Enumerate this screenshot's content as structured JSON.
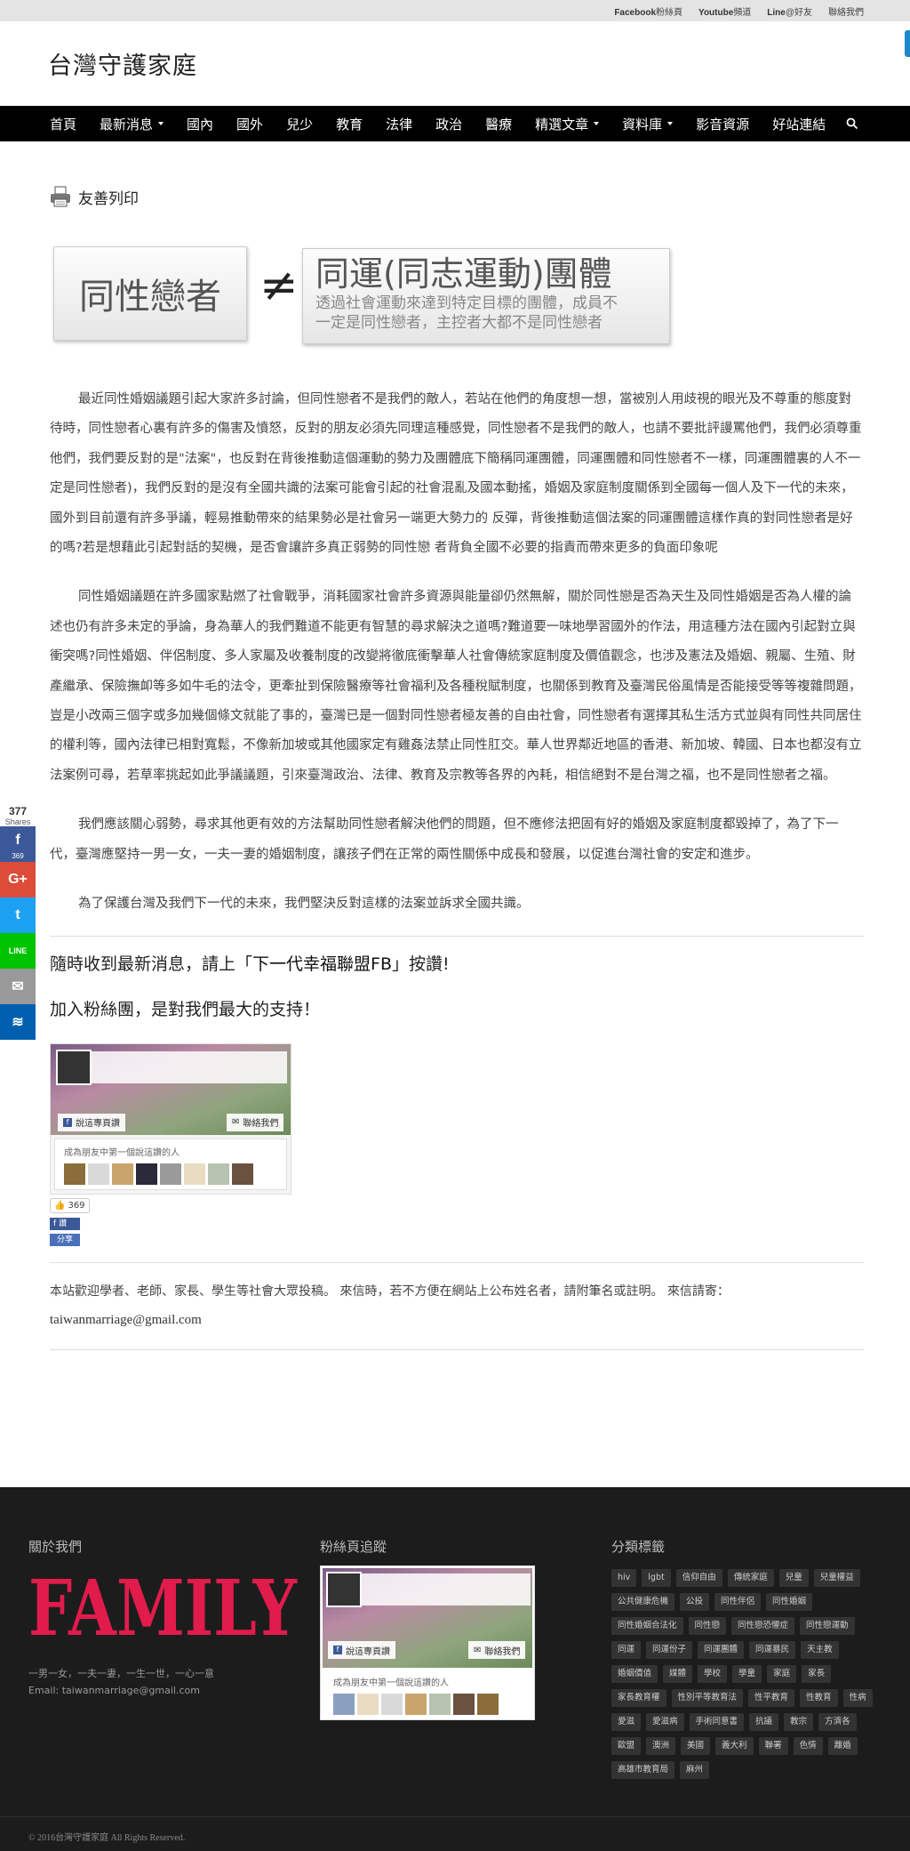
{
  "topbar": {
    "links": [
      {
        "bold": "Facebook",
        "rest": "粉絲頁"
      },
      {
        "bold": "Youtube",
        "rest": "頻道"
      },
      {
        "bold": "Line",
        "rest": "@好友"
      },
      {
        "bold": "",
        "rest": "聯絡我們"
      }
    ]
  },
  "site": {
    "title": "台灣守護家庭"
  },
  "nav": {
    "items": [
      {
        "label": "首頁",
        "dropdown": false
      },
      {
        "label": "最新消息",
        "dropdown": true
      },
      {
        "label": "國內",
        "dropdown": false
      },
      {
        "label": "國外",
        "dropdown": false
      },
      {
        "label": "兒少",
        "dropdown": false
      },
      {
        "label": "教育",
        "dropdown": false
      },
      {
        "label": "法律",
        "dropdown": false
      },
      {
        "label": "政治",
        "dropdown": false
      },
      {
        "label": "醫療",
        "dropdown": false
      },
      {
        "label": "精選文章",
        "dropdown": true
      },
      {
        "label": "資料庫",
        "dropdown": true
      },
      {
        "label": "影音資源",
        "dropdown": false
      },
      {
        "label": "好站連結",
        "dropdown": false
      }
    ],
    "search_icon": "search-icon"
  },
  "article": {
    "print_label": "友善列印",
    "banner": {
      "left": "同性戀者",
      "symbol": "≠",
      "right_title": "同運(同志運動)團體",
      "right_sub1": "透過社會運動來達到特定目標的團體，成員不",
      "right_sub2": "一定是同性戀者，主控者大都不是同性戀者"
    },
    "paragraphs": [
      "最近同性婚姻議題引起大家許多討論，但同性戀者不是我們的敵人，若站在他們的角度想一想，當被別人用歧視的眼光及不尊重的態度對待時，同性戀者心裏有許多的傷害及憤怒，反對的朋友必須先同理這種感覺，同性戀者不是我們的敵人，也請不要批評謾罵他們，我們必須尊重他們，我們要反對的是\"法案\"，也反對在背後推動這個運動的勢力及團體底下簡稱同運團體，同運團體和同性戀者不一樣，同運團體裏的人不一定是同性戀者)，我們反對的是沒有全國共識的法案可能會引起的社會混亂及國本動搖，婚姻及家庭制度關係到全國每一個人及下一代的未來，國外到目前還有許多爭議，輕易推動帶來的結果勢必是社會另一端更大勢力的 反彈，背後推動這個法案的同運團體這樣作真的對同性戀者是好的嗎?若是想藉此引起對話的契機，是否會讓許多真正弱勢的同性戀 者背負全國不必要的指責而帶來更多的負面印象呢",
      "同性婚姻議題在許多國家點燃了社會戰爭，消耗國家社會許多資源與能量卻仍然無解，關於同性戀是否為天生及同性婚姻是否為人權的論述也仍有許多未定的爭論，身為華人的我們難道不能更有智慧的尋求解決之道嗎?難道要一味地學習國外的作法，用這種方法在國內引起對立與衝突嗎?同性婚姻、伴侶制度、多人家屬及收養制度的改變將徹底衝擊華人社會傳統家庭制度及價值觀念，也涉及憲法及婚姻、親屬、生殖、財產繼承、保險撫卹等多如牛毛的法令，更牽扯到保險醫療等社會福利及各種稅賦制度，也關係到教育及臺灣民俗風情是否能接受等等複雜問題，豈是小改兩三個字或多加幾個條文就能了事的，臺灣已是一個對同性戀者極友善的自由社會，同性戀者有選擇其私生活方式並與有同性共同居住的權利等，國內法律已相對寬鬆，不像新加坡或其他國家定有雞姦法禁止同性肛交。華人世界鄰近地區的香港、新加坡、韓國、日本也都沒有立法案例可尋，若草率挑起如此爭議議題，引來臺灣政治、法律、教育及宗教等各界的內耗，相信絕對不是台灣之福，也不是同性戀者之福。",
      "我們應該關心弱勢，尋求其他更有效的方法幫助同性戀者解決他們的問題，但不應修法把固有好的婚姻及家庭制度都毀掉了，為了下一代，臺灣應堅持一男一女，一夫一妻的婚姻制度，讓孩子們在正常的兩性關係中成長和發展，以促進台灣社會的安定和進步。",
      "為了保護台灣及我們下一代的未來，我們堅決反對這樣的法案並訴求全國共識。"
    ],
    "fb_cta_prefix": "隨時收到最新消息，請上「",
    "fb_cta_link": "下一代幸福聯盟FB",
    "fb_cta_suffix": "」按讚!",
    "fans_cta": "加入粉絲團，是對我們最大的支持！",
    "fb_widget": {
      "like_page": "說這專頁讚",
      "contact": "聯絡我們",
      "friends_text": "成為朋友中第一個說這讚的人"
    },
    "like_count": "369",
    "like_btn": "讚",
    "share_btn": "分享",
    "contrib_text": "本站歡迎學者、老師、家長、學生等社會大眾投稿。 來信時，若不方便在網站上公布姓名者，請附筆名或註明。 來信請寄：",
    "contrib_email": "taiwanmarriage@gmail.com"
  },
  "share_bar": {
    "count": "377",
    "count_label": "Shares",
    "buttons": [
      {
        "name": "facebook",
        "icon": "f",
        "color": "#3b5998",
        "sub": "369"
      },
      {
        "name": "googleplus",
        "icon": "G+",
        "color": "#dd4b39",
        "sub": ""
      },
      {
        "name": "twitter",
        "icon": "t",
        "color": "#1da1f2",
        "sub": ""
      },
      {
        "name": "line",
        "icon": "LINE",
        "color": "#00c300",
        "sub": ""
      },
      {
        "name": "email",
        "icon": "✉",
        "color": "#999999",
        "sub": ""
      },
      {
        "name": "sumome",
        "icon": "≋",
        "color": "#0060af",
        "sub": ""
      }
    ]
  },
  "footer": {
    "about_title": "關於我們",
    "logo_text": "FAMILY",
    "logo_color": "#e11b4c",
    "about_line1": "一男一女，一夫一妻，一生一世，一心一意",
    "about_line2": "Email: taiwanmarriage@gmail.com",
    "fans_title": "粉絲頁追蹤",
    "fans_like": "說這專頁讚",
    "fans_contact": "聯絡我們",
    "fans_text": "成為朋友中第一個說這讚的人",
    "tags_title": "分類標籤",
    "tags": [
      "hiv",
      "lgbt",
      "信仰自由",
      "傳統家庭",
      "兒童",
      "兒童權益",
      "公共健康危機",
      "公投",
      "同性伴侶",
      "同性婚姻",
      "同性婚姻合法化",
      "同性戀",
      "同性戀恐懼症",
      "同性戀運動",
      "同運",
      "同運份子",
      "同運團體",
      "同運暴民",
      "天主教",
      "婚姻價值",
      "媒體",
      "學校",
      "學童",
      "家庭",
      "家長",
      "家長教育權",
      "性別平等教育法",
      "性平教育",
      "性教育",
      "性病",
      "愛滋",
      "愛滋病",
      "手術同意書",
      "抗議",
      "教宗",
      "方濟各",
      "歐盟",
      "澳洲",
      "美國",
      "義大利",
      "聯署",
      "色情",
      "離婚",
      "高雄市教育局",
      "麻州"
    ],
    "copyright": "© 2016台灣守護家庭 All Rights Reserved."
  }
}
